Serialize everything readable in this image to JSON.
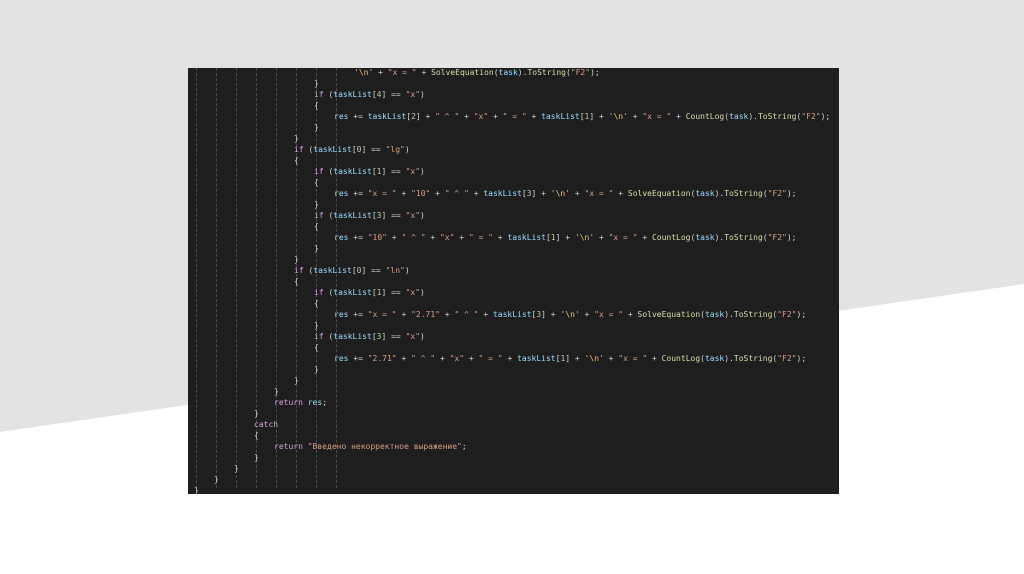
{
  "slide": {
    "background_color": "#ffffff",
    "band_color": "#e3e3e3",
    "code_background": "#1e1e1e"
  },
  "code": {
    "language": "C#",
    "lines": [
      {
        "indent": 8,
        "tokens": [
          [
            "ch",
            "'\\n'"
          ],
          [
            "punc",
            " + "
          ],
          [
            "str",
            "\"x = \""
          ],
          [
            "punc",
            " + "
          ],
          [
            "fn",
            "SolveEquation"
          ],
          [
            "punc",
            "("
          ],
          [
            "var",
            "task"
          ],
          [
            "punc",
            ")."
          ],
          [
            "fn",
            "ToString"
          ],
          [
            "punc",
            "("
          ],
          [
            "str",
            "\"F2\""
          ],
          [
            "punc",
            ");"
          ]
        ]
      },
      {
        "indent": 6,
        "tokens": [
          [
            "punc",
            "}"
          ]
        ]
      },
      {
        "indent": 6,
        "tokens": [
          [
            "kw",
            "if"
          ],
          [
            "punc",
            " ("
          ],
          [
            "var",
            "taskList"
          ],
          [
            "punc",
            "["
          ],
          [
            "num",
            "4"
          ],
          [
            "punc",
            "] == "
          ],
          [
            "str",
            "\"x\""
          ],
          [
            "punc",
            ")"
          ]
        ]
      },
      {
        "indent": 6,
        "tokens": [
          [
            "punc",
            "{"
          ]
        ]
      },
      {
        "indent": 7,
        "tokens": [
          [
            "var",
            "res"
          ],
          [
            "punc",
            " += "
          ],
          [
            "var",
            "taskList"
          ],
          [
            "punc",
            "["
          ],
          [
            "num",
            "2"
          ],
          [
            "punc",
            "] + "
          ],
          [
            "str",
            "\" ^ \""
          ],
          [
            "punc",
            " + "
          ],
          [
            "str",
            "\"x\""
          ],
          [
            "punc",
            " + "
          ],
          [
            "str",
            "\" = \""
          ],
          [
            "punc",
            " + "
          ],
          [
            "var",
            "taskList"
          ],
          [
            "punc",
            "["
          ],
          [
            "num",
            "1"
          ],
          [
            "punc",
            "] + "
          ],
          [
            "ch",
            "'\\n'"
          ],
          [
            "punc",
            " + "
          ],
          [
            "str",
            "\"x = \""
          ],
          [
            "punc",
            " + "
          ],
          [
            "fn",
            "CountLog"
          ],
          [
            "punc",
            "("
          ],
          [
            "var",
            "task"
          ],
          [
            "punc",
            ")."
          ],
          [
            "fn",
            "ToString"
          ],
          [
            "punc",
            "("
          ],
          [
            "str",
            "\"F2\""
          ],
          [
            "punc",
            ");"
          ]
        ]
      },
      {
        "indent": 6,
        "tokens": [
          [
            "punc",
            "}"
          ]
        ]
      },
      {
        "indent": 5,
        "tokens": [
          [
            "punc",
            "}"
          ]
        ]
      },
      {
        "indent": 5,
        "tokens": [
          [
            "kw",
            "if"
          ],
          [
            "punc",
            " ("
          ],
          [
            "var",
            "taskList"
          ],
          [
            "punc",
            "["
          ],
          [
            "num",
            "0"
          ],
          [
            "punc",
            "] == "
          ],
          [
            "str",
            "\"lg\""
          ],
          [
            "punc",
            ")"
          ]
        ]
      },
      {
        "indent": 5,
        "tokens": [
          [
            "punc",
            "{"
          ]
        ]
      },
      {
        "indent": 6,
        "tokens": [
          [
            "kw",
            "if"
          ],
          [
            "punc",
            " ("
          ],
          [
            "var",
            "taskList"
          ],
          [
            "punc",
            "["
          ],
          [
            "num",
            "1"
          ],
          [
            "punc",
            "] == "
          ],
          [
            "str",
            "\"x\""
          ],
          [
            "punc",
            ")"
          ]
        ]
      },
      {
        "indent": 6,
        "tokens": [
          [
            "punc",
            "{"
          ]
        ]
      },
      {
        "indent": 7,
        "tokens": [
          [
            "var",
            "res"
          ],
          [
            "punc",
            " += "
          ],
          [
            "str",
            "\"x = \""
          ],
          [
            "punc",
            " + "
          ],
          [
            "str",
            "\"10\""
          ],
          [
            "punc",
            " + "
          ],
          [
            "str",
            "\" ^ \""
          ],
          [
            "punc",
            " + "
          ],
          [
            "var",
            "taskList"
          ],
          [
            "punc",
            "["
          ],
          [
            "num",
            "3"
          ],
          [
            "punc",
            "] + "
          ],
          [
            "ch",
            "'\\n'"
          ],
          [
            "punc",
            " + "
          ],
          [
            "str",
            "\"x = \""
          ],
          [
            "punc",
            " + "
          ],
          [
            "fn",
            "SolveEquation"
          ],
          [
            "punc",
            "("
          ],
          [
            "var",
            "task"
          ],
          [
            "punc",
            ")."
          ],
          [
            "fn",
            "ToString"
          ],
          [
            "punc",
            "("
          ],
          [
            "str",
            "\"F2\""
          ],
          [
            "punc",
            ");"
          ]
        ]
      },
      {
        "indent": 6,
        "tokens": [
          [
            "punc",
            "}"
          ]
        ]
      },
      {
        "indent": 6,
        "tokens": [
          [
            "kw",
            "if"
          ],
          [
            "punc",
            " ("
          ],
          [
            "var",
            "taskList"
          ],
          [
            "punc",
            "["
          ],
          [
            "num",
            "3"
          ],
          [
            "punc",
            "] == "
          ],
          [
            "str",
            "\"x\""
          ],
          [
            "punc",
            ")"
          ]
        ]
      },
      {
        "indent": 6,
        "tokens": [
          [
            "punc",
            "{"
          ]
        ]
      },
      {
        "indent": 7,
        "tokens": [
          [
            "var",
            "res"
          ],
          [
            "punc",
            " += "
          ],
          [
            "str",
            "\"10\""
          ],
          [
            "punc",
            " + "
          ],
          [
            "str",
            "\" ^ \""
          ],
          [
            "punc",
            " + "
          ],
          [
            "str",
            "\"x\""
          ],
          [
            "punc",
            " + "
          ],
          [
            "str",
            "\" = \""
          ],
          [
            "punc",
            " + "
          ],
          [
            "var",
            "taskList"
          ],
          [
            "punc",
            "["
          ],
          [
            "num",
            "1"
          ],
          [
            "punc",
            "] + "
          ],
          [
            "ch",
            "'\\n'"
          ],
          [
            "punc",
            " + "
          ],
          [
            "str",
            "\"x = \""
          ],
          [
            "punc",
            " + "
          ],
          [
            "fn",
            "CountLog"
          ],
          [
            "punc",
            "("
          ],
          [
            "var",
            "task"
          ],
          [
            "punc",
            ")."
          ],
          [
            "fn",
            "ToString"
          ],
          [
            "punc",
            "("
          ],
          [
            "str",
            "\"F2\""
          ],
          [
            "punc",
            ");"
          ]
        ]
      },
      {
        "indent": 6,
        "tokens": [
          [
            "punc",
            "}"
          ]
        ]
      },
      {
        "indent": 5,
        "tokens": [
          [
            "punc",
            "}"
          ]
        ]
      },
      {
        "indent": 5,
        "tokens": [
          [
            "kw",
            "if"
          ],
          [
            "punc",
            " ("
          ],
          [
            "var",
            "taskList"
          ],
          [
            "punc",
            "["
          ],
          [
            "num",
            "0"
          ],
          [
            "punc",
            "] == "
          ],
          [
            "str",
            "\"ln\""
          ],
          [
            "punc",
            ")"
          ]
        ]
      },
      {
        "indent": 5,
        "tokens": [
          [
            "punc",
            "{"
          ]
        ]
      },
      {
        "indent": 6,
        "tokens": [
          [
            "kw",
            "if"
          ],
          [
            "punc",
            " ("
          ],
          [
            "var",
            "taskList"
          ],
          [
            "punc",
            "["
          ],
          [
            "num",
            "1"
          ],
          [
            "punc",
            "] == "
          ],
          [
            "str",
            "\"x\""
          ],
          [
            "punc",
            ")"
          ]
        ]
      },
      {
        "indent": 6,
        "tokens": [
          [
            "punc",
            "{"
          ]
        ]
      },
      {
        "indent": 7,
        "tokens": [
          [
            "var",
            "res"
          ],
          [
            "punc",
            " += "
          ],
          [
            "str",
            "\"x = \""
          ],
          [
            "punc",
            " + "
          ],
          [
            "str",
            "\"2.71\""
          ],
          [
            "punc",
            " + "
          ],
          [
            "str",
            "\" ^ \""
          ],
          [
            "punc",
            " + "
          ],
          [
            "var",
            "taskList"
          ],
          [
            "punc",
            "["
          ],
          [
            "num",
            "3"
          ],
          [
            "punc",
            "] + "
          ],
          [
            "ch",
            "'\\n'"
          ],
          [
            "punc",
            " + "
          ],
          [
            "str",
            "\"x = \""
          ],
          [
            "punc",
            " + "
          ],
          [
            "fn",
            "SolveEquation"
          ],
          [
            "punc",
            "("
          ],
          [
            "var",
            "task"
          ],
          [
            "punc",
            ")."
          ],
          [
            "fn",
            "ToString"
          ],
          [
            "punc",
            "("
          ],
          [
            "str",
            "\"F2\""
          ],
          [
            "punc",
            ");"
          ]
        ]
      },
      {
        "indent": 6,
        "tokens": [
          [
            "punc",
            "}"
          ]
        ]
      },
      {
        "indent": 6,
        "tokens": [
          [
            "kw",
            "if"
          ],
          [
            "punc",
            " ("
          ],
          [
            "var",
            "taskList"
          ],
          [
            "punc",
            "["
          ],
          [
            "num",
            "3"
          ],
          [
            "punc",
            "] == "
          ],
          [
            "str",
            "\"x\""
          ],
          [
            "punc",
            ")"
          ]
        ]
      },
      {
        "indent": 6,
        "tokens": [
          [
            "punc",
            "{"
          ]
        ]
      },
      {
        "indent": 7,
        "tokens": [
          [
            "var",
            "res"
          ],
          [
            "punc",
            " += "
          ],
          [
            "str",
            "\"2.71\""
          ],
          [
            "punc",
            " + "
          ],
          [
            "str",
            "\" ^ \""
          ],
          [
            "punc",
            " + "
          ],
          [
            "str",
            "\"x\""
          ],
          [
            "punc",
            " + "
          ],
          [
            "str",
            "\" = \""
          ],
          [
            "punc",
            " + "
          ],
          [
            "var",
            "taskList"
          ],
          [
            "punc",
            "["
          ],
          [
            "num",
            "1"
          ],
          [
            "punc",
            "] + "
          ],
          [
            "ch",
            "'\\n'"
          ],
          [
            "punc",
            " + "
          ],
          [
            "str",
            "\"x = \""
          ],
          [
            "punc",
            " + "
          ],
          [
            "fn",
            "CountLog"
          ],
          [
            "punc",
            "("
          ],
          [
            "var",
            "task"
          ],
          [
            "punc",
            ")."
          ],
          [
            "fn",
            "ToString"
          ],
          [
            "punc",
            "("
          ],
          [
            "str",
            "\"F2\""
          ],
          [
            "punc",
            ");"
          ]
        ]
      },
      {
        "indent": 6,
        "tokens": [
          [
            "punc",
            "}"
          ]
        ]
      },
      {
        "indent": 5,
        "tokens": [
          [
            "punc",
            "}"
          ]
        ]
      },
      {
        "indent": 4,
        "tokens": [
          [
            "punc",
            "}"
          ]
        ]
      },
      {
        "indent": 4,
        "tokens": [
          [
            "kw",
            "return"
          ],
          [
            "punc",
            " "
          ],
          [
            "var",
            "res"
          ],
          [
            "punc",
            ";"
          ]
        ]
      },
      {
        "indent": 3,
        "tokens": [
          [
            "punc",
            "}"
          ]
        ]
      },
      {
        "indent": 3,
        "tokens": [
          [
            "kw",
            "catch"
          ]
        ]
      },
      {
        "indent": 3,
        "tokens": [
          [
            "punc",
            "{"
          ]
        ]
      },
      {
        "indent": 4,
        "tokens": [
          [
            "kw",
            "return"
          ],
          [
            "punc",
            " "
          ],
          [
            "str",
            "\"Введено некорректное выражение\""
          ],
          [
            "punc",
            ";"
          ]
        ]
      },
      {
        "indent": 3,
        "tokens": [
          [
            "punc",
            "}"
          ]
        ]
      },
      {
        "indent": 2,
        "tokens": [
          [
            "punc",
            "}"
          ]
        ]
      },
      {
        "indent": 1,
        "tokens": [
          [
            "punc",
            "}"
          ]
        ]
      },
      {
        "indent": 0,
        "tokens": [
          [
            "punc",
            "}"
          ]
        ]
      }
    ]
  }
}
